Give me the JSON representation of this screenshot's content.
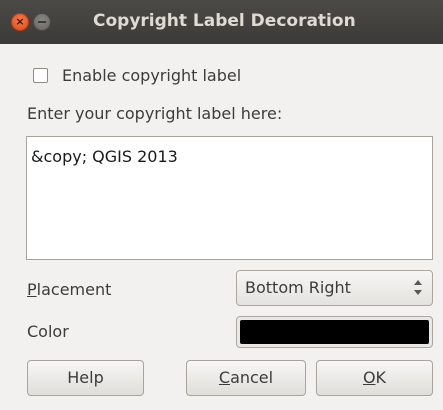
{
  "window": {
    "title": "Copyright Label Decoration",
    "close_glyph": "×"
  },
  "enable_checkbox": {
    "label": "Enable copyright label",
    "checked": false
  },
  "label_prompt": "Enter your copyright label here:",
  "label_text": "&copy; QGIS 2013",
  "placement": {
    "label_mnemonic": "P",
    "label_rest": "lacement",
    "value": "Bottom Right"
  },
  "color": {
    "label": "Color",
    "value": "#000000"
  },
  "buttons": {
    "help": "Help",
    "cancel_mnemonic": "C",
    "cancel_rest": "ancel",
    "ok_mnemonic": "O",
    "ok_rest": "K"
  },
  "icons": {
    "close": "close-icon",
    "minimize": "minimize-icon",
    "spinner": "up-down-arrows-icon"
  }
}
